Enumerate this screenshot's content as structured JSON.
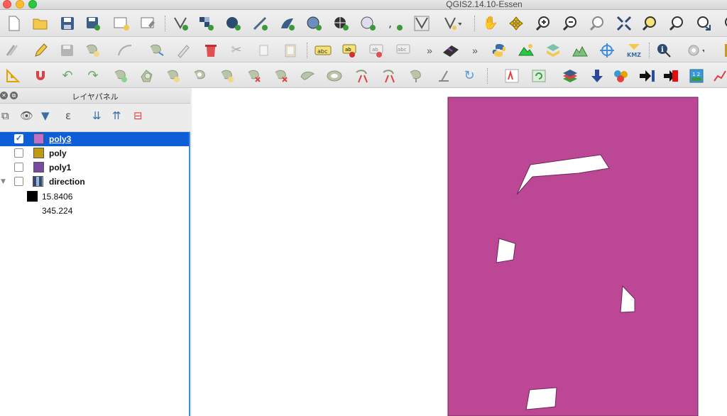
{
  "window": {
    "title": "QGIS2.14.10-Essen"
  },
  "toolbar1": {
    "icons": [
      "new-project-icon",
      "open-project-icon",
      "save-project-icon",
      "save-as-icon",
      "new-print-composer-icon",
      "composer-manager-icon",
      "add-vector-layer-icon",
      "add-raster-layer-icon",
      "add-postgis-layer-icon",
      "add-spatialite-layer-icon",
      "add-mssql-layer-icon",
      "add-wms-layer-icon",
      "add-wcs-layer-icon",
      "add-wfs-layer-icon",
      "add-delimited-text-icon",
      "add-virtual-layer-icon",
      "new-layer-dropdown-icon",
      "pan-icon",
      "pan-to-selection-icon",
      "zoom-in-icon",
      "zoom-out-icon",
      "zoom-actual-icon",
      "zoom-full-icon",
      "zoom-to-selection-icon",
      "zoom-to-layer-icon",
      "zoom-last-icon",
      "zoom-next-icon"
    ]
  },
  "toolbar2": {
    "overflow_label": "»"
  },
  "panel": {
    "title": "レイヤパネル"
  },
  "layers": [
    {
      "name": "poly3",
      "checked": true,
      "selected": true,
      "color": "#c070c8"
    },
    {
      "name": "poly",
      "checked": false,
      "selected": false,
      "color": "#c09a10"
    },
    {
      "name": "poly1",
      "checked": false,
      "selected": false,
      "color": "#7a4aa0"
    },
    {
      "name": "direction",
      "checked": false,
      "selected": false,
      "expanded": true
    }
  ],
  "direction_legend": {
    "value_high": "15.8406",
    "value_low": "345.224"
  },
  "map": {
    "fill_color": "#bb4795",
    "background": "#ffffff"
  }
}
